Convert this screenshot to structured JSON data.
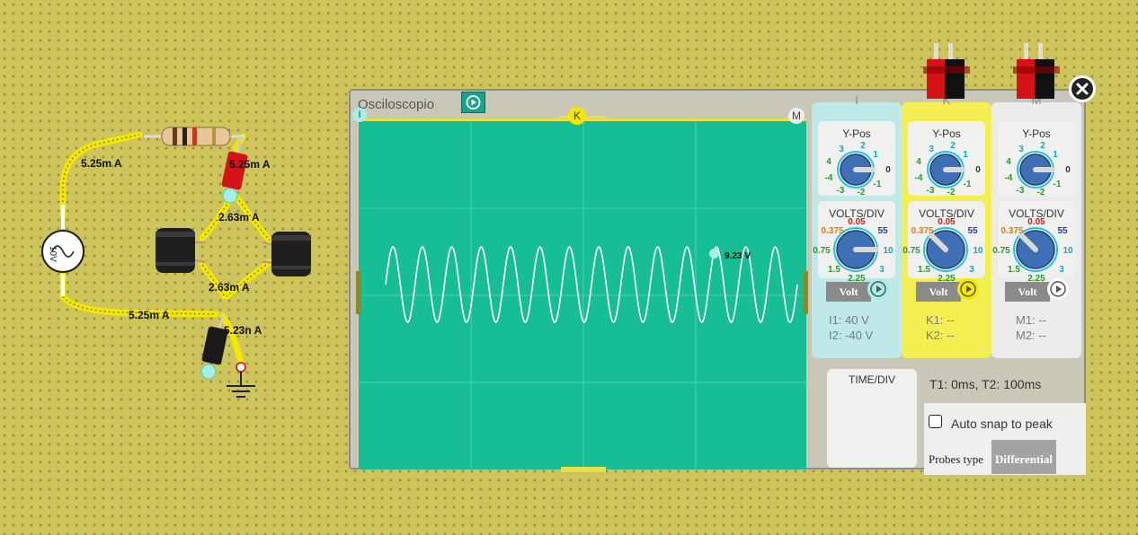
{
  "circuit": {
    "labels": {
      "current_top_left": "5.25m A",
      "current_top_right": "5.25m A",
      "current_mid_upper": "2.63m A",
      "current_mid_lower": "2.63m A",
      "current_bottom_left": "5.25m A",
      "current_bottom_right": "5.23n A"
    },
    "source_label": "10V"
  },
  "oscilloscope": {
    "title": "Osciloscopio",
    "markers": {
      "i": "I",
      "k": "K",
      "m": "M"
    },
    "measurement_label": "9.23 V",
    "channels": [
      {
        "name": "I",
        "ypos_title": "Y-Pos",
        "volts_title": "VOLTS/DIV",
        "button": "Volt",
        "readouts": [
          "I1: 40 V",
          "I2: -40 V"
        ]
      },
      {
        "name": "K",
        "ypos_title": "Y-Pos",
        "volts_title": "VOLTS/DIV",
        "button": "Volt",
        "readouts": [
          "K1: --",
          "K2: --"
        ]
      },
      {
        "name": "M",
        "ypos_title": "Y-Pos",
        "volts_title": "VOLTS/DIV",
        "button": "Volt",
        "readouts": [
          "M1: --",
          "M2: --"
        ]
      }
    ],
    "ypos_scale": [
      "3",
      "2",
      "1",
      "4",
      "0",
      "-4",
      "-1",
      "-3",
      "-2"
    ],
    "volts_scale": [
      "0.05",
      "0.375",
      "55",
      "0.75",
      "10",
      "1.5",
      "2.25",
      "3"
    ],
    "time_div": {
      "title": "TIME/DIV",
      "scale": [
        "10µ",
        "2µ",
        "0.5µ",
        "50µ",
        "0.1m",
        "10m",
        "0.5m",
        "1m",
        "5m"
      ]
    },
    "t_readout": "T1: 0ms, T2: 100ms",
    "auto_snap_label": "Auto snap to peak",
    "auto_snap_checked": false,
    "probes_label": "Probes type",
    "probes_value": "Differential",
    "colors": {
      "screen": "#17bd94",
      "trace": "#ffffff",
      "channel_i": "#bfe8e8",
      "channel_k": "#f3ee52",
      "channel_m": "#ececec"
    }
  }
}
